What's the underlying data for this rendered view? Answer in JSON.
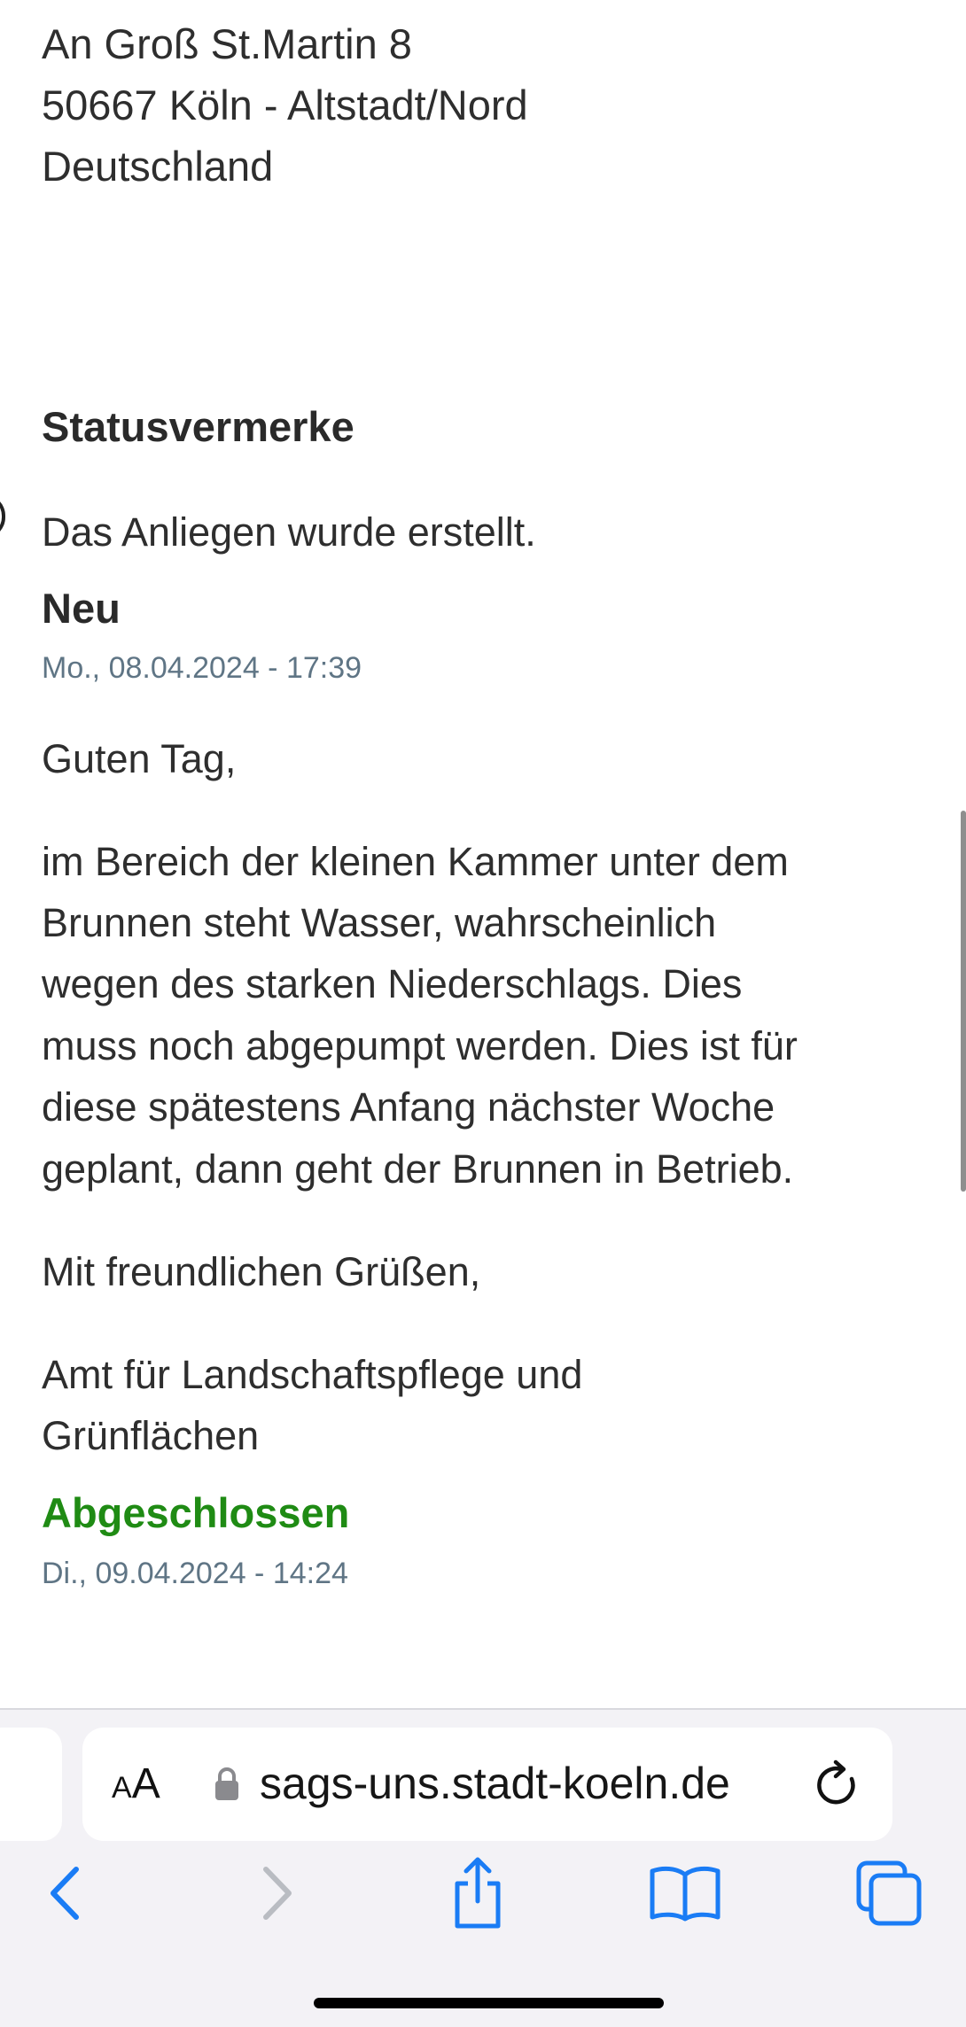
{
  "address": {
    "line1": "An Groß St.Martin 8",
    "line2": "50667 Köln - Altstadt/Nord",
    "line3": "Deutschland"
  },
  "status_section": {
    "title": "Statusvermerke",
    "entry1": {
      "message": "Das Anliegen wurde erstellt.",
      "status": "Neu",
      "timestamp": "Mo., 08.04.2024 - 17:39"
    },
    "entry2": {
      "greeting": "Guten Tag,",
      "body_lines": [
        "im Bereich der kleinen Kammer unter dem",
        "Brunnen steht Wasser, wahrscheinlich",
        "wegen des starken Niederschlags. Dies",
        "muss noch abgepumpt werden. Dies ist für",
        "diese spätestens Anfang nächster Woche",
        "geplant, dann geht der Brunnen in Betrieb."
      ],
      "closing": "Mit freundlichen Grüßen,",
      "signature_lines": [
        "Amt für Landschaftspflege und",
        "Grünflächen"
      ],
      "status": "Abgeschlossen",
      "status_color": "#1f8b14",
      "timestamp": "Di., 09.04.2024 - 14:24"
    }
  },
  "browser": {
    "text_size_label_small": "A",
    "text_size_label_large": "A",
    "url": "sags-uns.stadt-koeln.de",
    "icons": [
      "lock-icon",
      "reload-icon",
      "back-icon",
      "forward-icon",
      "share-icon",
      "bookmarks-icon",
      "tabs-icon"
    ],
    "accent_color": "#1a7cf5"
  }
}
